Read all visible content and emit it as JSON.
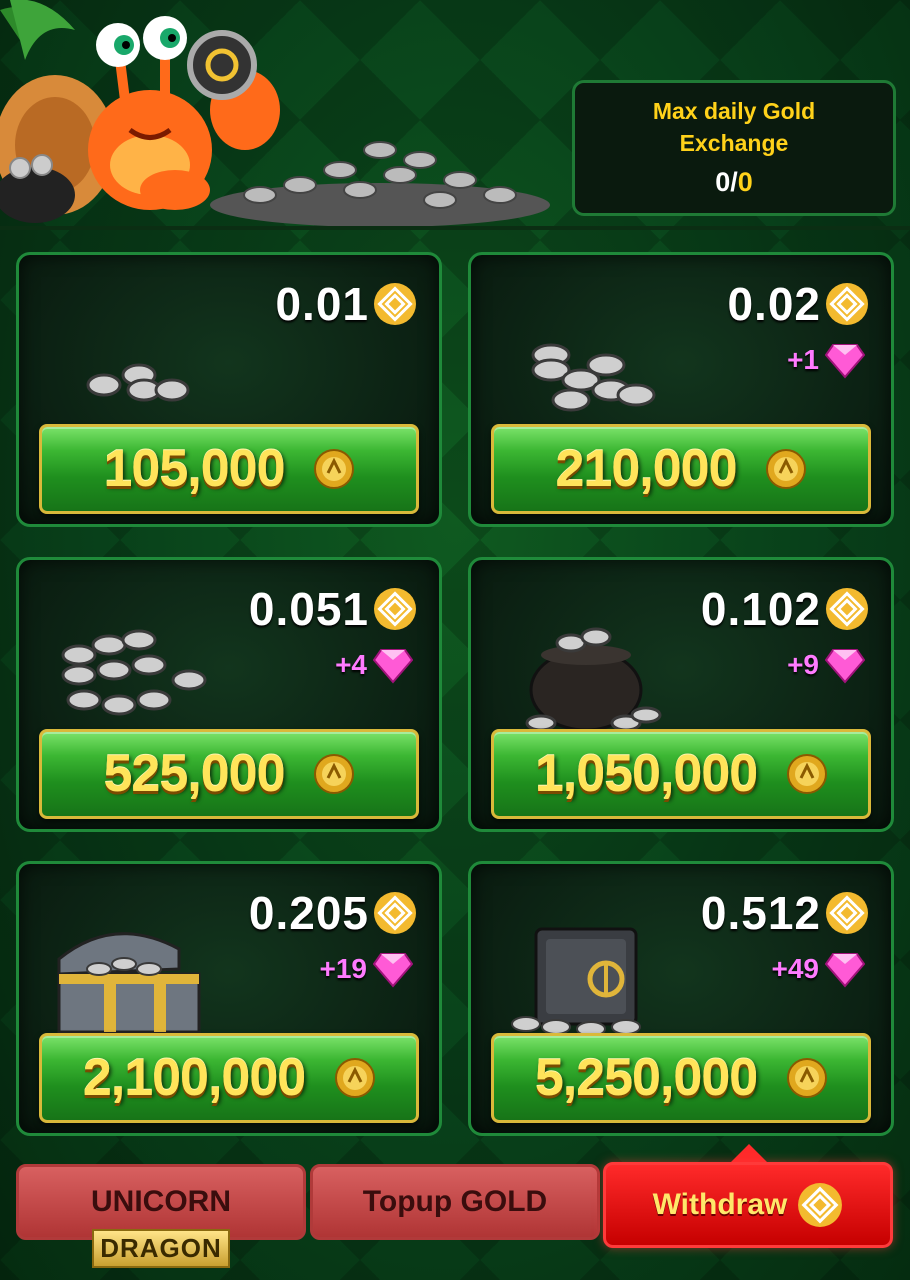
{
  "header": {
    "max_daily": {
      "label": "Max daily Gold Exchange",
      "used": "0/",
      "limit": "0"
    }
  },
  "packages": [
    {
      "price": "0.01",
      "bonus": "",
      "gold": "105,000",
      "art": "coins-small"
    },
    {
      "price": "0.02",
      "bonus": "+1",
      "gold": "210,000",
      "art": "coins-pile"
    },
    {
      "price": "0.051",
      "bonus": "+4",
      "gold": "525,000",
      "art": "coins-stacks"
    },
    {
      "price": "0.102",
      "bonus": "+9",
      "gold": "1,050,000",
      "art": "coin-pot"
    },
    {
      "price": "0.205",
      "bonus": "+19",
      "gold": "2,100,000",
      "art": "treasure-chest"
    },
    {
      "price": "0.512",
      "bonus": "+49",
      "gold": "5,250,000",
      "art": "vault-safe"
    }
  ],
  "tabs": {
    "unicorn": "UNICORN",
    "dragon": "DRAGON",
    "topup": "Topup GOLD",
    "withdraw": "Withdraw"
  },
  "icons": {
    "price_currency": "bnb-coin-icon",
    "bonus": "pink-gem-icon",
    "gold": "gold-coin-icon"
  },
  "colors": {
    "gold_text": "#ffe45a",
    "gem_text": "#ff7bff",
    "button_green": "#2fa82a",
    "tab_active": "#ff2a2a",
    "tab_inactive": "#c84848"
  }
}
